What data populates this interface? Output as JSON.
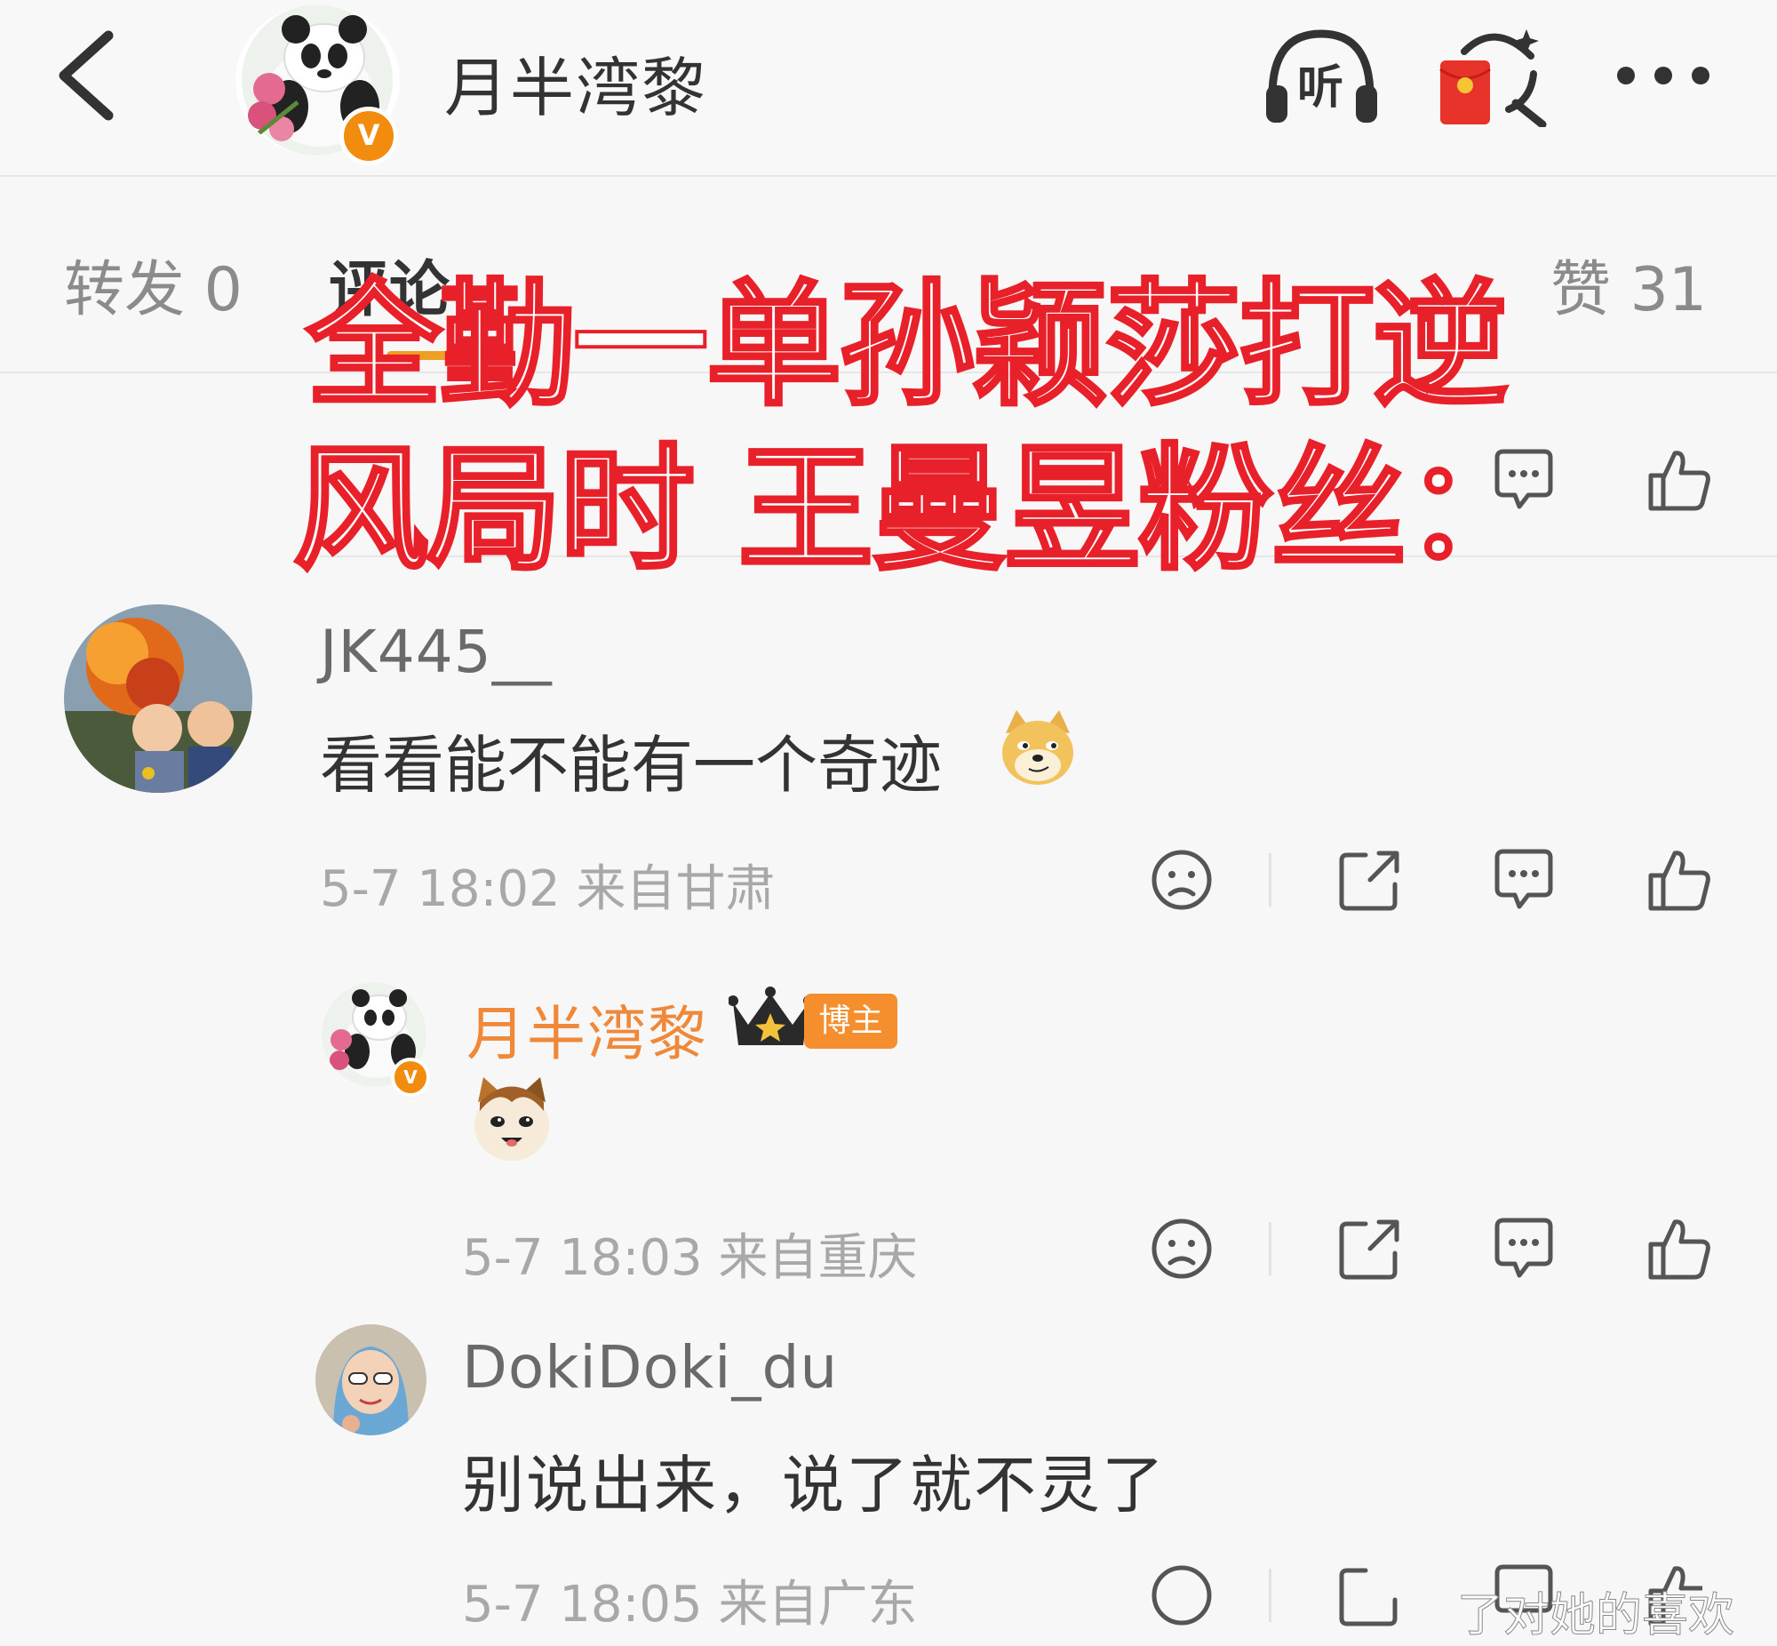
{
  "header": {
    "title": "月半湾黎",
    "listen_label": "听",
    "verified_badge": "V"
  },
  "tabs": {
    "repost": "转发 0",
    "comment": "评论",
    "like": "赞 31"
  },
  "overlay": {
    "line1": "全勤一单孙颖莎打逆",
    "line2": "风局时 王曼昱粉丝："
  },
  "comments": [
    {
      "username": "JK445__",
      "text": "看看能不能有一个奇迹",
      "meta": "5-7 18:02  来自甘肃",
      "emoji": "doge-emoji"
    },
    {
      "username": "DokiDoki_du",
      "text": "别说出来，说了就不灵了",
      "meta": "5-7 18:05  来自广东"
    }
  ],
  "reply": {
    "username": "月半湾黎",
    "badge": "博主",
    "meta": "5-7 18:03  来自重庆",
    "emoji": "cat-emoji"
  },
  "watermark": "了对她的喜欢",
  "colors": {
    "overlay_red": "#e8202a",
    "author_orange": "#f0883a",
    "verified_orange": "#f28c0f",
    "badge_orange": "#f58e2c"
  }
}
